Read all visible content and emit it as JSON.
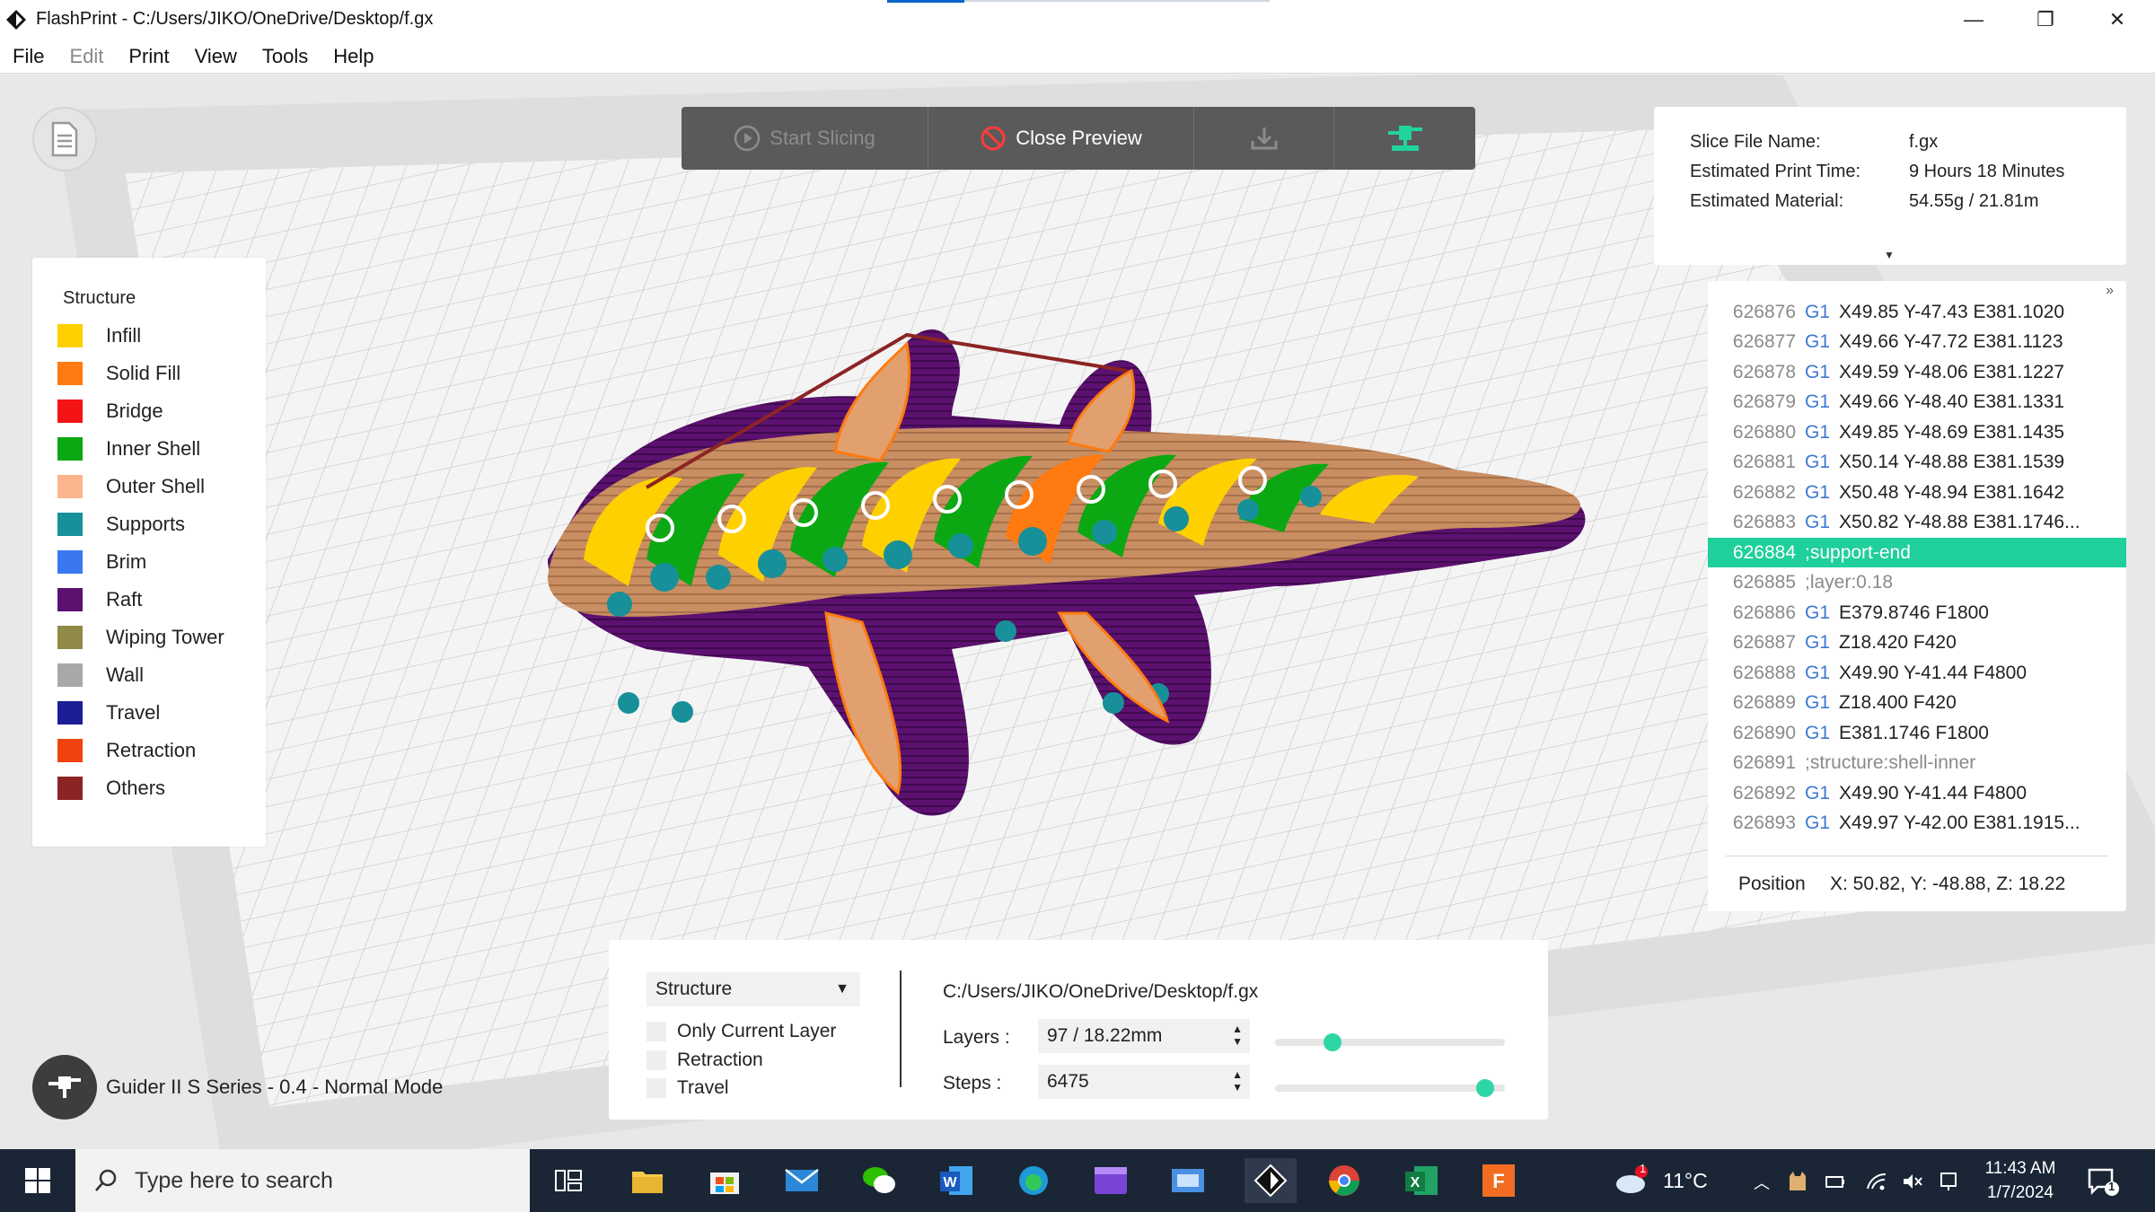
{
  "window": {
    "title": "FlashPrint - C:/Users/JIKO/OneDrive/Desktop/f.gx",
    "minimize_icon": "—",
    "maximize_icon": "❐",
    "close_icon": "✕"
  },
  "menu": [
    "File",
    "Edit",
    "Print",
    "View",
    "Tools",
    "Help"
  ],
  "toolbar": {
    "start_slicing": "Start Slicing",
    "close_preview": "Close Preview"
  },
  "legend": {
    "title": "Structure",
    "items": [
      {
        "label": "Infill",
        "color": "#ffd000"
      },
      {
        "label": "Solid Fill",
        "color": "#ff7a10"
      },
      {
        "label": "Bridge",
        "color": "#f41414"
      },
      {
        "label": "Inner Shell",
        "color": "#0ca814"
      },
      {
        "label": "Outer Shell",
        "color": "#fcb48c"
      },
      {
        "label": "Supports",
        "color": "#17909a"
      },
      {
        "label": "Brim",
        "color": "#3a78f2"
      },
      {
        "label": "Raft",
        "color": "#5c1170"
      },
      {
        "label": "Wiping Tower",
        "color": "#8f8a45"
      },
      {
        "label": "Wall",
        "color": "#a8a8a8"
      },
      {
        "label": "Travel",
        "color": "#1d1d96"
      },
      {
        "label": "Retraction",
        "color": "#f0420e"
      },
      {
        "label": "Others",
        "color": "#8c2424"
      }
    ]
  },
  "info": {
    "file_name_label": "Slice File Name:",
    "file_name": "f.gx",
    "print_time_label": "Estimated Print Time:",
    "print_time": "9 Hours 18 Minutes",
    "material_label": "Estimated Material:",
    "material": "54.55g / 21.81m"
  },
  "gcode": {
    "lines": [
      {
        "num": "626876",
        "cmd": "G1",
        "text": "X49.85 Y-47.43 E381.1020"
      },
      {
        "num": "626877",
        "cmd": "G1",
        "text": "X49.66 Y-47.72 E381.1123"
      },
      {
        "num": "626878",
        "cmd": "G1",
        "text": "X49.59 Y-48.06 E381.1227"
      },
      {
        "num": "626879",
        "cmd": "G1",
        "text": "X49.66 Y-48.40 E381.1331"
      },
      {
        "num": "626880",
        "cmd": "G1",
        "text": "X49.85 Y-48.69 E381.1435"
      },
      {
        "num": "626881",
        "cmd": "G1",
        "text": "X50.14 Y-48.88 E381.1539"
      },
      {
        "num": "626882",
        "cmd": "G1",
        "text": "X50.48 Y-48.94 E381.1642"
      },
      {
        "num": "626883",
        "cmd": "G1",
        "text": "X50.82 Y-48.88 E381.1746..."
      },
      {
        "num": "626884",
        "cmd": "",
        "text": ";support-end"
      },
      {
        "num": "626885",
        "cmd": "",
        "text": ";layer:0.18"
      },
      {
        "num": "626886",
        "cmd": "G1",
        "text": "E379.8746 F1800"
      },
      {
        "num": "626887",
        "cmd": "G1",
        "text": "Z18.420 F420"
      },
      {
        "num": "626888",
        "cmd": "G1",
        "text": "X49.90 Y-41.44 F4800"
      },
      {
        "num": "626889",
        "cmd": "G1",
        "text": "Z18.400 F420"
      },
      {
        "num": "626890",
        "cmd": "G1",
        "text": "E381.1746 F1800"
      },
      {
        "num": "626891",
        "cmd": "",
        "text": ";structure:shell-inner"
      },
      {
        "num": "626892",
        "cmd": "G1",
        "text": "X49.90 Y-41.44 F4800"
      },
      {
        "num": "626893",
        "cmd": "G1",
        "text": "X49.97 Y-42.00 E381.1915..."
      }
    ],
    "active_line": "626884",
    "position_label": "Position",
    "position_value": "X: 50.82, Y: -48.88, Z: 18.22",
    "active_color": "#1fcf9c"
  },
  "controls": {
    "mode_select": "Structure",
    "only_current_layer": "Only Current Layer",
    "retraction": "Retraction",
    "travel": "Travel",
    "file_path": "C:/Users/JIKO/OneDrive/Desktop/f.gx",
    "layers_label": "Layers :",
    "layers_value": "97 / 18.22mm",
    "steps_label": "Steps :",
    "steps_value": "6475",
    "layers_slider_fraction": 0.23,
    "steps_slider_fraction": 0.95
  },
  "printer": {
    "label": "Guider II S Series - 0.4 - Normal Mode"
  },
  "taskbar": {
    "search_placeholder": "Type here to search",
    "temperature": "11°C",
    "weather_badge": "1",
    "time": "11:43 AM",
    "date": "1/7/2024",
    "notification_count": "1"
  }
}
